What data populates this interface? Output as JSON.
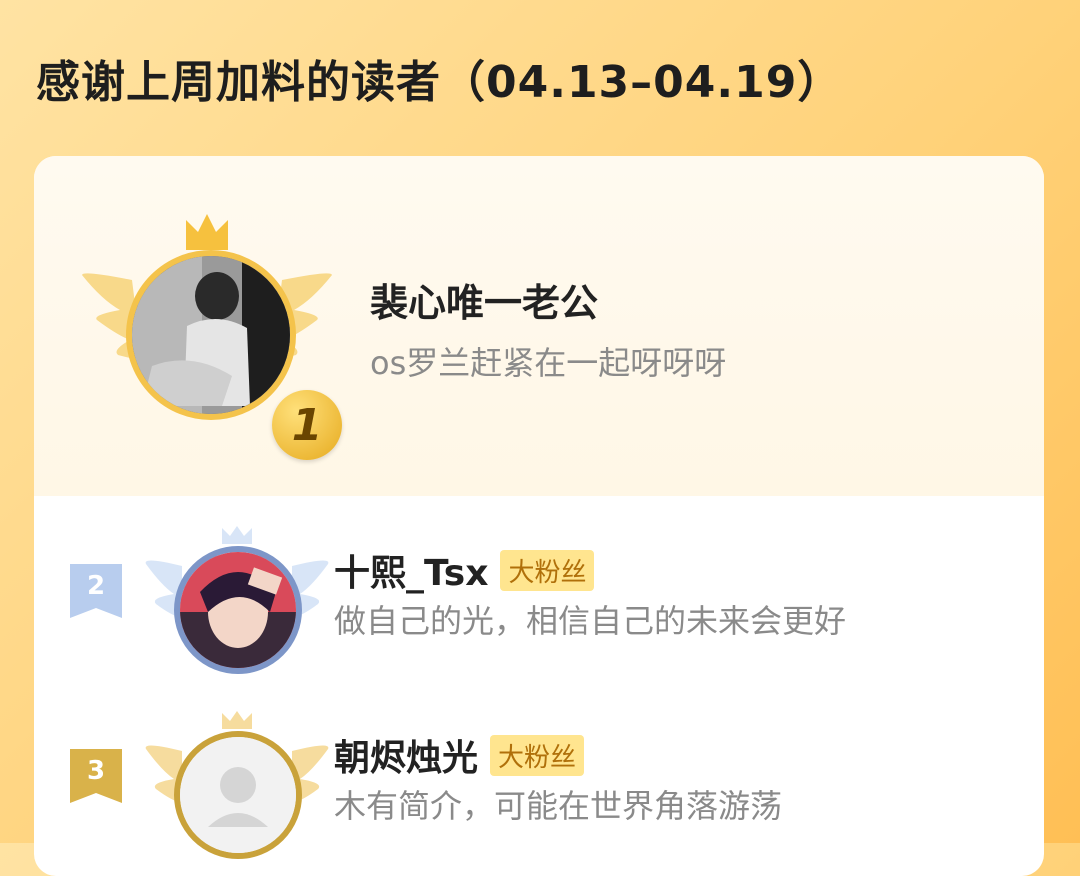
{
  "header": {
    "title": "感谢上周加料的读者（04.13–04.19）"
  },
  "top_reader": {
    "rank": "1",
    "name": "裴心唯一老公",
    "bio": "os罗兰赶紧在一起呀呀呀"
  },
  "readers": [
    {
      "rank": "2",
      "name": "十熙_Tsx",
      "badge": "大粉丝",
      "bio": "做自己的光，相信自己的未来会更好",
      "rank_color": "#a9c3e8",
      "ring_color": "#7d96c8"
    },
    {
      "rank": "3",
      "name": "朝烬烛光",
      "badge": "大粉丝",
      "bio": "木有简介，可能在世界角落游荡",
      "rank_color": "#d9b24a",
      "ring_color": "#c9a23a"
    }
  ],
  "colors": {
    "gold": "#f4c34b",
    "badge_bg": "#ffe58f",
    "badge_text": "#b0700a"
  }
}
